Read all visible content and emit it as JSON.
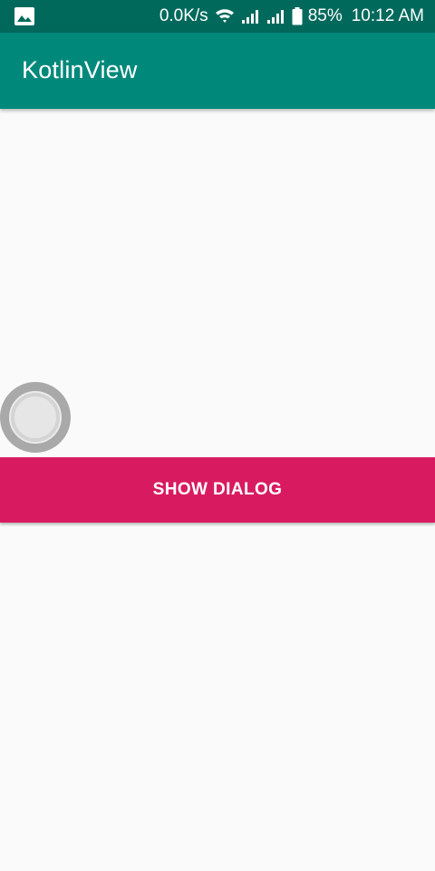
{
  "status_bar": {
    "left_icon": "image-icon",
    "net_speed": "0.0K/s",
    "icons": [
      "wifi-icon",
      "signal-icon",
      "signal-icon",
      "battery-icon"
    ],
    "battery": "85%",
    "time": "10:12 AM"
  },
  "app_bar": {
    "title": "KotlinView",
    "color": "#00897B"
  },
  "content": {
    "radio": {
      "icon": "radio-button-icon",
      "checked": false
    },
    "button": {
      "label": "SHOW DIALOG",
      "color": "#D81B60"
    }
  },
  "colors": {
    "status_bar": "#00695C",
    "background": "#FAFAFA"
  }
}
